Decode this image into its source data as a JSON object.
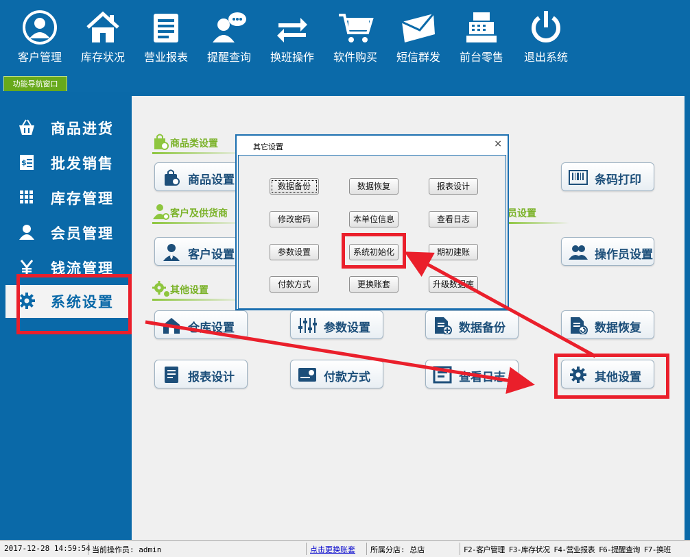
{
  "toolbar": {
    "items": [
      {
        "label": "客户管理",
        "icon": "customer-icon"
      },
      {
        "label": "库存状况",
        "icon": "home-icon"
      },
      {
        "label": "营业报表",
        "icon": "report-icon"
      },
      {
        "label": "提醒查询",
        "icon": "chat-user-icon"
      },
      {
        "label": "换班操作",
        "icon": "swap-icon"
      },
      {
        "label": "软件购买",
        "icon": "cart-icon"
      },
      {
        "label": "短信群发",
        "icon": "envelope-icon"
      },
      {
        "label": "前台零售",
        "icon": "cash-register-icon"
      },
      {
        "label": "退出系统",
        "icon": "power-icon"
      }
    ]
  },
  "nav_tab": "功能导航窗口",
  "sidebar": {
    "items": [
      {
        "label": "商品进货",
        "icon": "basket-icon"
      },
      {
        "label": "批发销售",
        "icon": "invoice-icon"
      },
      {
        "label": "库存管理",
        "icon": "grid-icon"
      },
      {
        "label": "会员管理",
        "icon": "person-icon"
      },
      {
        "label": "钱流管理",
        "icon": "yen-icon"
      },
      {
        "label": "系统设置",
        "icon": "gear-icon",
        "active": true
      }
    ]
  },
  "sections": {
    "goods": "商品类设置",
    "customer": "客户及供货商",
    "operator": "员设置",
    "other": "其他设置"
  },
  "buttons": {
    "goods_setting": "商品设置",
    "barcode_print": "条码打印",
    "customer_setting": "客户设置",
    "operator_setting": "操作员设置",
    "warehouse_setting": "仓库设置",
    "param_setting": "参数设置",
    "data_backup": "数据备份",
    "data_restore": "数据恢复",
    "report_design": "报表设计",
    "payment_method": "付款方式",
    "view_log": "查看日志",
    "other_setting": "其他设置"
  },
  "dialog": {
    "title": "其它设置",
    "close": "×",
    "buttons": [
      "数据备份",
      "数据恢复",
      "报表设计",
      "修改密码",
      "本单位信息",
      "查看日志",
      "参数设置",
      "系统初始化",
      "期初建账",
      "付款方式",
      "更换账套",
      "升级数据库"
    ]
  },
  "status": {
    "datetime": "2017-12-28 14:59:54",
    "operator": "当前操作员: admin",
    "switch_link": "点击更换账套",
    "branch": "所属分店: 总店",
    "shortcuts": "F2-客户管理 F3-库存状况 F4-营业报表 F6-提醒查询 F7-换班"
  },
  "colors": {
    "primary": "#0b6aa9",
    "accent_green": "#7ab228",
    "annotation_red": "#ea1f2b"
  }
}
